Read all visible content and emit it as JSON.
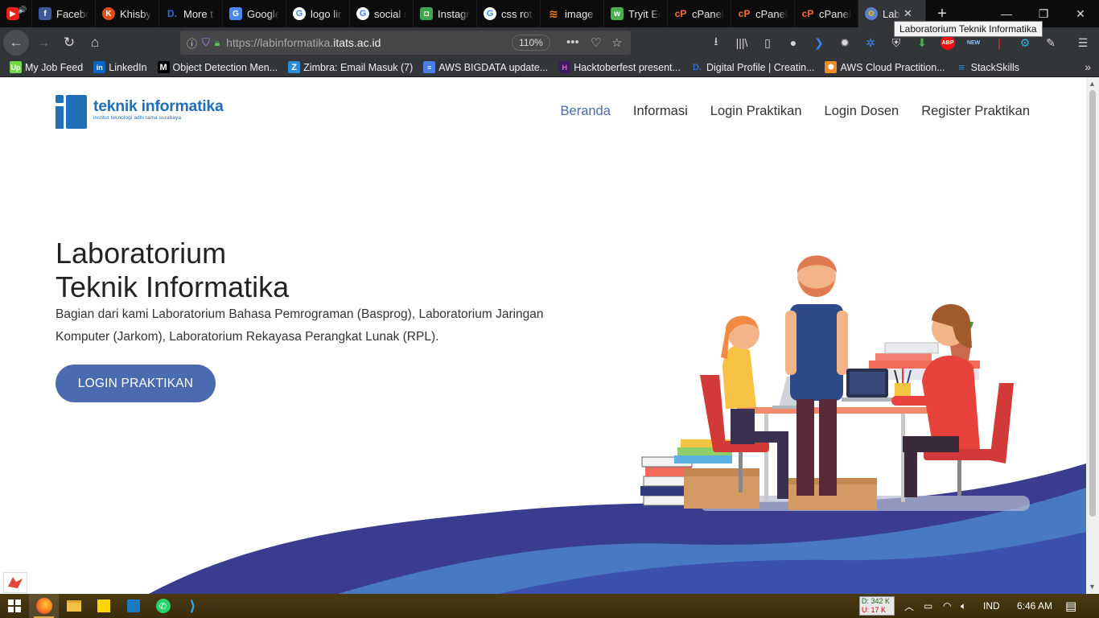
{
  "tabs": [
    {
      "label": "",
      "icon": "youtube-icon"
    },
    {
      "label": "Facebook",
      "icon": "facebook-icon"
    },
    {
      "label": "Khisby",
      "icon": "khisby-icon"
    },
    {
      "label": "More t",
      "icon": "dev-icon"
    },
    {
      "label": "Google",
      "icon": "google-translate-icon"
    },
    {
      "label": "logo lin",
      "icon": "google-icon"
    },
    {
      "label": "social r",
      "icon": "google-icon"
    },
    {
      "label": "Instagr",
      "icon": "instagram-icon"
    },
    {
      "label": "css rota",
      "icon": "google-icon"
    },
    {
      "label": "image",
      "icon": "stackoverflow-icon"
    },
    {
      "label": "Tryit Ed",
      "icon": "tryit-icon"
    },
    {
      "label": "cPanel",
      "icon": "cpanel-icon"
    },
    {
      "label": "cPanel",
      "icon": "cpanel-icon"
    },
    {
      "label": "cPanel",
      "icon": "cpanel-icon"
    },
    {
      "label": "Lab",
      "icon": "lab-icon",
      "active": true
    }
  ],
  "tooltip": "Laboratorium Teknik Informatika",
  "url": {
    "prefix": "https://labinformatika.",
    "domain": "itats.ac.id",
    "zoom": "110%"
  },
  "bookmarks": [
    {
      "label": "My Job Feed",
      "icon": "upwork-icon",
      "color": "#6fda44"
    },
    {
      "label": "LinkedIn",
      "icon": "linkedin-icon",
      "color": "#0a66c2"
    },
    {
      "label": "Object Detection Men...",
      "icon": "medium-icon",
      "color": "#000000"
    },
    {
      "label": "Zimbra: Email Masuk (7)",
      "icon": "zimbra-icon",
      "color": "#2c8ed6"
    },
    {
      "label": "AWS BIGDATA update...",
      "icon": "docs-icon",
      "color": "#4a7de8"
    },
    {
      "label": "Hacktoberfest present...",
      "icon": "hacktoberfest-icon",
      "color": "#3b1e5f"
    },
    {
      "label": "Digital Profile | Creatin...",
      "icon": "dev-icon",
      "color": "#2e6cd8"
    },
    {
      "label": "AWS Cloud Practition...",
      "icon": "aws-icon",
      "color": "#f08a24"
    },
    {
      "label": "StackSkills",
      "icon": "stackskills-icon",
      "color": "#2c8ed6"
    }
  ],
  "site": {
    "logo_title": "teknik informatika",
    "logo_subtitle": "institut teknologi adhi tama surabaya",
    "nav": [
      "Beranda",
      "Informasi",
      "Login Praktikan",
      "Login Dosen",
      "Register Praktikan"
    ],
    "hero_title_line1": "Laboratorium",
    "hero_title_line2": "Teknik Informatika",
    "hero_desc": "Bagian dari kami Laboratorium Bahasa Pemrograman (Basprog), Laboratorium Jaringan Komputer (Jarkom), Laboratorium Rekayasa Perangkat Lunak (RPL).",
    "hero_button": "LOGIN PRAKTIKAN"
  },
  "taskbar": {
    "net_down": "D: 342 K",
    "net_up": "U: 17 K",
    "lang": "IND",
    "time": "6:46 AM"
  },
  "colors": {
    "brand": "#1f6fb9",
    "accent": "#4a6bb0",
    "wave_dark": "#3a3d8f",
    "wave_light": "#4a7fc8"
  }
}
